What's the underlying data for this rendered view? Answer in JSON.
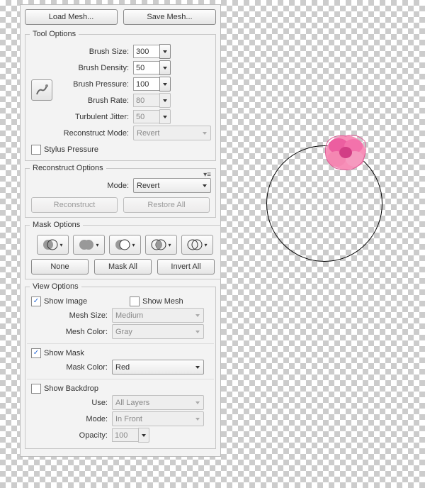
{
  "buttons": {
    "loadMesh": "Load Mesh...",
    "saveMesh": "Save Mesh...",
    "reconstruct": "Reconstruct",
    "restoreAll": "Restore All",
    "none": "None",
    "maskAll": "Mask All",
    "invertAll": "Invert All"
  },
  "tool": {
    "legend": "Tool Options",
    "brushSizeLabel": "Brush Size:",
    "brushSize": "300",
    "brushDensityLabel": "Brush Density:",
    "brushDensity": "50",
    "brushPressureLabel": "Brush Pressure:",
    "brushPressure": "100",
    "brushRateLabel": "Brush Rate:",
    "brushRate": "80",
    "turbJitterLabel": "Turbulent Jitter:",
    "turbJitter": "50",
    "reconModeLabel": "Reconstruct Mode:",
    "reconMode": "Revert",
    "stylus": "Stylus Pressure"
  },
  "recon": {
    "legend": "Reconstruct Options",
    "modeLabel": "Mode:",
    "mode": "Revert"
  },
  "mask": {
    "legend": "Mask Options"
  },
  "view": {
    "legend": "View Options",
    "showImage": "Show Image",
    "showMesh": "Show Mesh",
    "meshSizeLabel": "Mesh Size:",
    "meshSize": "Medium",
    "meshColorLabel": "Mesh Color:",
    "meshColor": "Gray",
    "showMask": "Show Mask",
    "maskColorLabel": "Mask Color:",
    "maskColor": "Red",
    "showBackdrop": "Show Backdrop",
    "useLabel": "Use:",
    "use": "All Layers",
    "modeLabel": "Mode:",
    "mode": "In Front",
    "opacityLabel": "Opacity:",
    "opacity": "100"
  }
}
